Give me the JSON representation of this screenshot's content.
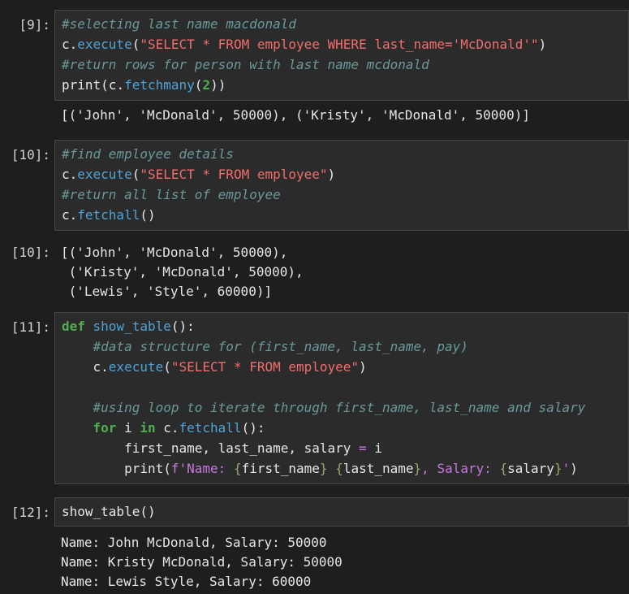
{
  "cells": [
    {
      "prompt": "[9]:",
      "code": [
        [
          {
            "t": "#selecting last name macdonald",
            "c": "cm"
          }
        ],
        [
          {
            "t": "c.",
            "c": "df"
          },
          {
            "t": "execute",
            "c": "fn"
          },
          {
            "t": "(",
            "c": "df"
          },
          {
            "t": "\"SELECT * FROM employee WHERE last_name='McDonald'\"",
            "c": "st"
          },
          {
            "t": ")",
            "c": "df"
          }
        ],
        [
          {
            "t": "#return rows for person with last name mcdonald",
            "c": "cm"
          }
        ],
        [
          {
            "t": "print",
            "c": "df"
          },
          {
            "t": "(c.",
            "c": "df"
          },
          {
            "t": "fetchmany",
            "c": "fn"
          },
          {
            "t": "(",
            "c": "df"
          },
          {
            "t": "2",
            "c": "kw"
          },
          {
            "t": "))",
            "c": "df"
          }
        ]
      ],
      "output_prompt": "",
      "output": [
        "[('John', 'McDonald', 50000), ('Kristy', 'McDonald', 50000)]"
      ]
    },
    {
      "prompt": "[10]:",
      "code": [
        [
          {
            "t": "#find employee details",
            "c": "cm"
          }
        ],
        [
          {
            "t": "c.",
            "c": "df"
          },
          {
            "t": "execute",
            "c": "fn"
          },
          {
            "t": "(",
            "c": "df"
          },
          {
            "t": "\"SELECT * FROM employee\"",
            "c": "st"
          },
          {
            "t": ")",
            "c": "df"
          }
        ],
        [
          {
            "t": "#return all list of employee",
            "c": "cm"
          }
        ],
        [
          {
            "t": "c.",
            "c": "df"
          },
          {
            "t": "fetchall",
            "c": "fn"
          },
          {
            "t": "()",
            "c": "df"
          }
        ]
      ],
      "output_prompt": "[10]:",
      "output": [
        "[('John', 'McDonald', 50000),",
        " ('Kristy', 'McDonald', 50000),",
        " ('Lewis', 'Style', 60000)]"
      ]
    },
    {
      "prompt": "[11]:",
      "code": [
        [
          {
            "t": "def ",
            "c": "kw"
          },
          {
            "t": "show_table",
            "c": "fn"
          },
          {
            "t": "():",
            "c": "df"
          }
        ],
        [
          {
            "t": "    ",
            "c": "df"
          },
          {
            "t": "#data structure for (first_name, last_name, pay)",
            "c": "cm"
          }
        ],
        [
          {
            "t": "    c.",
            "c": "df"
          },
          {
            "t": "execute",
            "c": "fn"
          },
          {
            "t": "(",
            "c": "df"
          },
          {
            "t": "\"SELECT * FROM employee\"",
            "c": "st"
          },
          {
            "t": ")",
            "c": "df"
          }
        ],
        [
          {
            "t": "",
            "c": "df"
          }
        ],
        [
          {
            "t": "    ",
            "c": "df"
          },
          {
            "t": "#using loop to iterate through first_name, last_name and salary",
            "c": "cm"
          }
        ],
        [
          {
            "t": "    ",
            "c": "df"
          },
          {
            "t": "for ",
            "c": "kw"
          },
          {
            "t": "i ",
            "c": "df"
          },
          {
            "t": "in ",
            "c": "kw"
          },
          {
            "t": "c.",
            "c": "df"
          },
          {
            "t": "fetchall",
            "c": "fn"
          },
          {
            "t": "():",
            "c": "df"
          }
        ],
        [
          {
            "t": "        first_name, last_name, salary ",
            "c": "df"
          },
          {
            "t": "=",
            "c": "op"
          },
          {
            "t": " i",
            "c": "df"
          }
        ],
        [
          {
            "t": "        print",
            "c": "df"
          },
          {
            "t": "(",
            "c": "df"
          },
          {
            "t": "f'Name: ",
            "c": "fs"
          },
          {
            "t": "{",
            "c": "br"
          },
          {
            "t": "first_name",
            "c": "df"
          },
          {
            "t": "}",
            "c": "br"
          },
          {
            "t": " ",
            "c": "fs"
          },
          {
            "t": "{",
            "c": "br"
          },
          {
            "t": "last_name",
            "c": "df"
          },
          {
            "t": "}",
            "c": "br"
          },
          {
            "t": ", Salary: ",
            "c": "fs"
          },
          {
            "t": "{",
            "c": "br"
          },
          {
            "t": "salary",
            "c": "df"
          },
          {
            "t": "}",
            "c": "br"
          },
          {
            "t": "'",
            "c": "fs"
          },
          {
            "t": ")",
            "c": "df"
          }
        ]
      ],
      "output_prompt": "",
      "output": []
    },
    {
      "prompt": "[12]:",
      "code": [
        [
          {
            "t": "show_table()",
            "c": "df"
          }
        ]
      ],
      "output_prompt": "",
      "output": [
        "Name: John McDonald, Salary: 50000",
        "Name: Kristy McDonald, Salary: 50000",
        "Name: Lewis Style, Salary: 60000"
      ]
    }
  ]
}
